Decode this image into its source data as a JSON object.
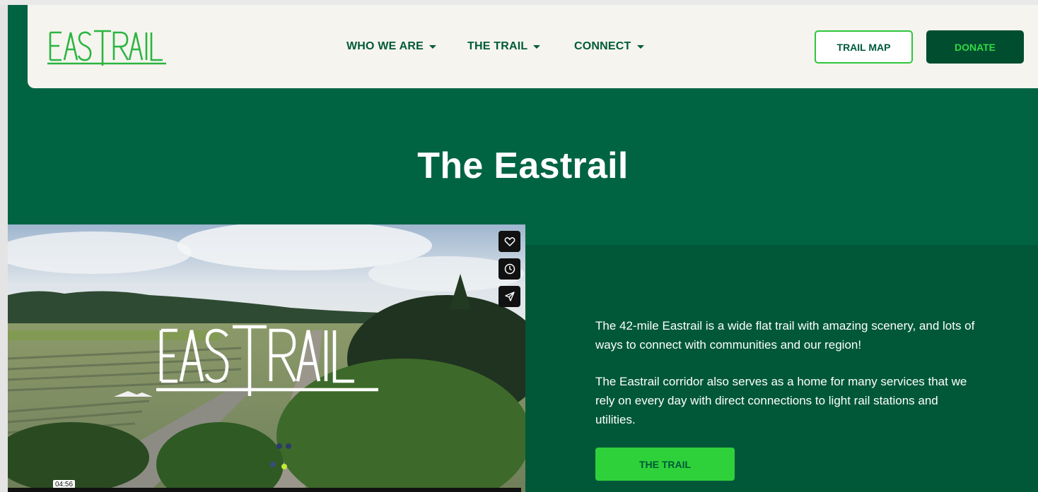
{
  "brand": {
    "logo_text": "EASTRAIL",
    "primary_color": "#006442",
    "accent_color": "#2ed13a"
  },
  "nav": {
    "items": [
      {
        "label": "WHO WE ARE"
      },
      {
        "label": "THE TRAIL"
      },
      {
        "label": "CONNECT"
      }
    ],
    "trail_map_label": "TRAIL MAP",
    "donate_label": "DONATE"
  },
  "hero": {
    "title": "The Eastrail"
  },
  "video": {
    "overlay_logo_text": "EASTRAIL",
    "duration": "04:56",
    "actions": [
      "heart-icon",
      "clock-icon",
      "send-icon"
    ]
  },
  "intro": {
    "paragraph_1": "The 42-mile Eastrail is a wide flat trail with amazing scenery, and lots of ways to connect with communities and our region!",
    "paragraph_2": "The Eastrail corridor also serves as a home for many services that we rely on every day with direct connections to light rail stations and utilities.",
    "button_label": "THE TRAIL"
  }
}
